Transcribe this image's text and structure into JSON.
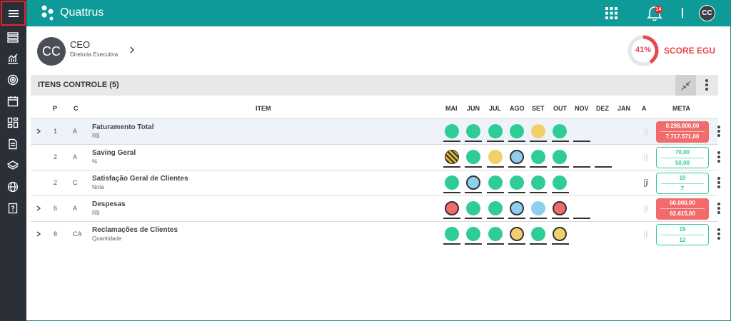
{
  "app": {
    "brand": "Quattrus",
    "notifications": "14",
    "user_initials": "CC"
  },
  "header": {
    "initials": "CC",
    "role": "CEO",
    "department": "Diretoria Executiva",
    "score_pct": "41%",
    "score_value": 0.41,
    "score_label": "SCORE EGU"
  },
  "section": {
    "title": "ITENS CONTROLE (5)"
  },
  "columns": {
    "p": "P",
    "c": "C",
    "item": "ITEM",
    "months": [
      "MAI",
      "JUN",
      "JUL",
      "AGO",
      "SET",
      "OUT",
      "NOV",
      "DEZ",
      "JAN"
    ],
    "a": "A",
    "meta": "META"
  },
  "rows": [
    {
      "p": "1",
      "c": "A",
      "name": "Faturamento Total",
      "unit": "R$",
      "meta_top": "8.298.800,00",
      "meta_bottom": "7.717.571,00",
      "meta_color": "red",
      "dots": [
        "g",
        "g",
        "g",
        "g",
        "y",
        "g"
      ],
      "ring": [
        false,
        false,
        false,
        false,
        false,
        false
      ]
    },
    {
      "p": "2",
      "c": "A",
      "name": "Saving Geral",
      "unit": "%",
      "meta_top": "70,00",
      "meta_bottom": "50,00",
      "meta_color": "green",
      "dots": [
        "stripe",
        "g",
        "y",
        "b",
        "g",
        "g"
      ],
      "ring": [
        false,
        false,
        false,
        true,
        false,
        false
      ]
    },
    {
      "p": "2",
      "c": "C",
      "name": "Satisfação Geral de Clientes",
      "unit": "Nota",
      "meta_top": "10",
      "meta_bottom": "7",
      "meta_color": "green",
      "dots": [
        "g",
        "b",
        "g",
        "g",
        "g",
        "g"
      ],
      "ring": [
        false,
        true,
        false,
        false,
        false,
        false
      ]
    },
    {
      "p": "6",
      "c": "A",
      "name": "Despesas",
      "unit": "R$",
      "meta_top": "60.000,00",
      "meta_bottom": "62.615,00",
      "meta_color": "red",
      "dots": [
        "r",
        "g",
        "g",
        "b",
        "b",
        "r"
      ],
      "ring": [
        true,
        false,
        false,
        true,
        false,
        true
      ]
    },
    {
      "p": "8",
      "c": "CA",
      "name": "Reclamações de Clientes",
      "unit": "Quantidade",
      "meta_top": "15",
      "meta_bottom": "12",
      "meta_color": "green",
      "dots": [
        "g",
        "g",
        "g",
        "y",
        "g",
        "y"
      ],
      "ring": [
        false,
        false,
        false,
        true,
        false,
        true
      ]
    }
  ],
  "colors": {
    "teal": "#0d9a98",
    "sidebar": "#2b2f38",
    "green": "#2fcc96",
    "red": "#f26b6b",
    "yellow": "#f1d06b",
    "blue": "#8ecfee"
  }
}
